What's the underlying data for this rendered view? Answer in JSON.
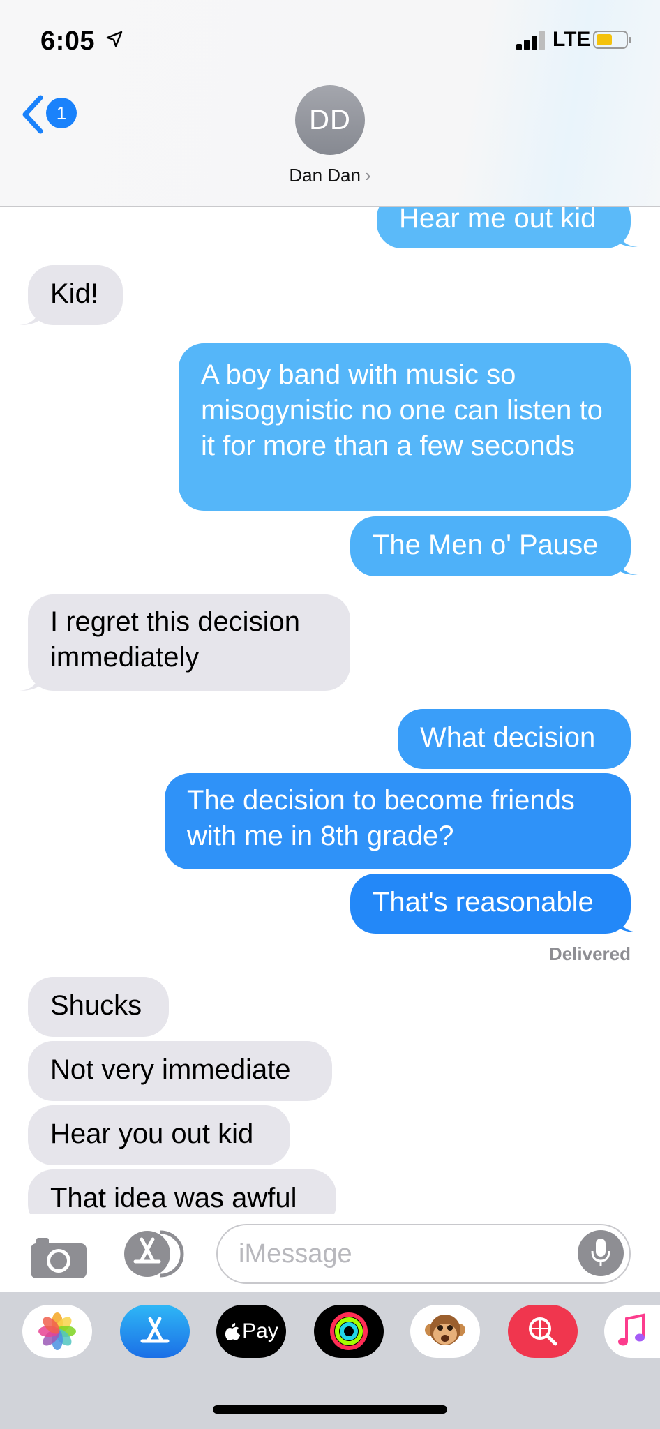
{
  "status_bar": {
    "time": "6:05",
    "network": "LTE",
    "signal_bars": 3,
    "signal_bars_total": 4,
    "battery_level": 0.55
  },
  "header": {
    "back_badge": "1",
    "avatar_initials": "DD",
    "contact_name": "Dan Dan",
    "chevron": "›"
  },
  "messages": [
    {
      "side": "out",
      "text": "Hear me out kid"
    },
    {
      "side": "in",
      "text": "Kid!"
    },
    {
      "side": "out",
      "text": "A boy band with music so misogynistic no one can listen to it for more than a few seconds"
    },
    {
      "side": "out",
      "text": "The Men o' Pause"
    },
    {
      "side": "in",
      "text": "I regret this decision immediately"
    },
    {
      "side": "out",
      "text": "What decision"
    },
    {
      "side": "out",
      "text": "The decision to become friends with me in 8th grade?"
    },
    {
      "side": "out",
      "text": "That's reasonable"
    },
    {
      "side": "in",
      "text": "Shucks"
    },
    {
      "side": "in",
      "text": "Not very immediate"
    },
    {
      "side": "in",
      "text": "Hear you out kid"
    },
    {
      "side": "in",
      "text": "That idea was awful"
    }
  ],
  "delivered_label": "Delivered",
  "input": {
    "placeholder": "iMessage"
  },
  "drawer": {
    "apps": [
      {
        "name": "Photos",
        "icon": "photos-icon"
      },
      {
        "name": "App Store",
        "icon": "app-store-icon"
      },
      {
        "name": "Apple Pay",
        "icon": "apple-pay-icon",
        "label": "Pay"
      },
      {
        "name": "Activity",
        "icon": "activity-icon"
      },
      {
        "name": "Animoji",
        "icon": "animoji-monkey-icon"
      },
      {
        "name": "Images",
        "icon": "image-search-icon"
      },
      {
        "name": "Music",
        "icon": "music-icon"
      }
    ]
  },
  "colors": {
    "outgoing_top": "#5ab8f9",
    "outgoing_bottom": "#1f86f8",
    "incoming": "#e6e5eb",
    "accent": "#1a82fb"
  }
}
